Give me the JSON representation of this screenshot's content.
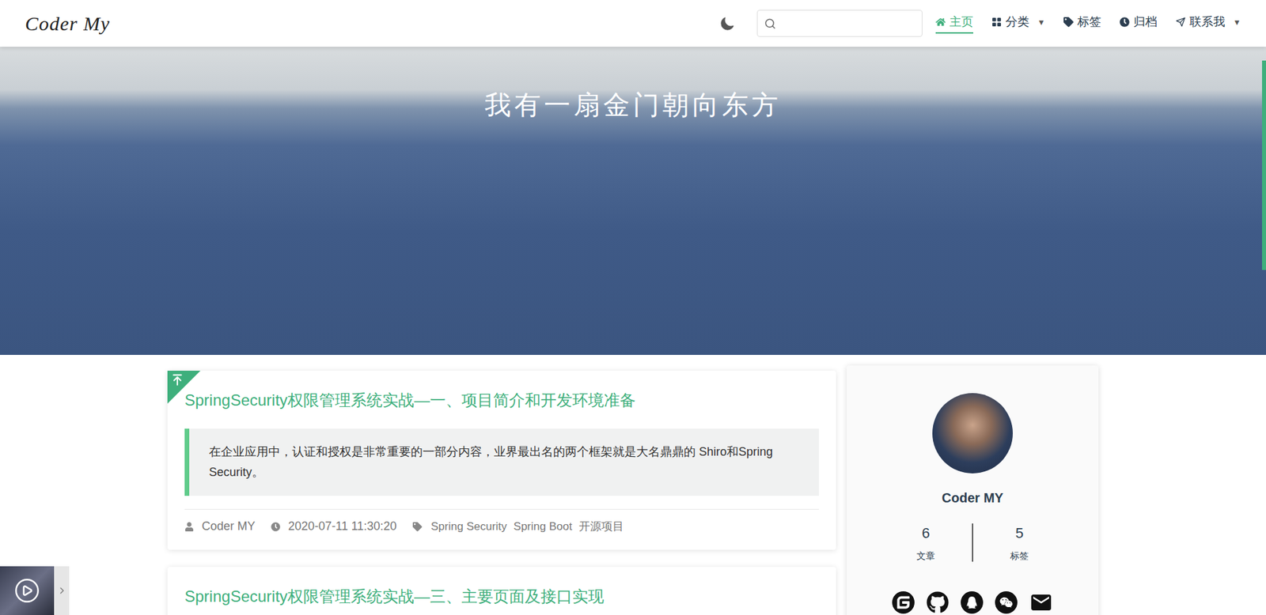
{
  "header": {
    "logo": "Coder My",
    "search": {
      "placeholder": ""
    },
    "nav": [
      {
        "label": "主页",
        "selected": true,
        "caret": ""
      },
      {
        "label": "分类",
        "selected": false,
        "caret": "▼"
      },
      {
        "label": "标签",
        "selected": false,
        "caret": ""
      },
      {
        "label": "归档",
        "selected": false,
        "caret": ""
      },
      {
        "label": "联系我",
        "selected": false,
        "caret": "▼"
      }
    ]
  },
  "hero": {
    "title": "我有一扇金门朝向东方"
  },
  "posts": [
    {
      "title": "SpringSecurity权限管理系统实战—一、项目简介和开发环境准备",
      "pinned": true,
      "excerpt": "在企业应用中，认证和授权是非常重要的一部分内容，业界最出名的两个框架就是大名鼎鼎的 Shiro和Spring Security。",
      "author": "Coder MY",
      "date": "2020-07-11 11:30:20",
      "tags": [
        "Spring Security",
        "Spring Boot",
        "开源项目"
      ]
    },
    {
      "title": "SpringSecurity权限管理系统实战—三、主要页面及接口实现",
      "pinned": false,
      "excerpt": "",
      "author": "",
      "date": "",
      "tags": []
    }
  ],
  "profile": {
    "name": "Coder MY",
    "stats": [
      {
        "value": "6",
        "label": "文章"
      },
      {
        "value": "5",
        "label": "标签"
      }
    ]
  },
  "reading_progress": {
    "level": 0.34
  }
}
